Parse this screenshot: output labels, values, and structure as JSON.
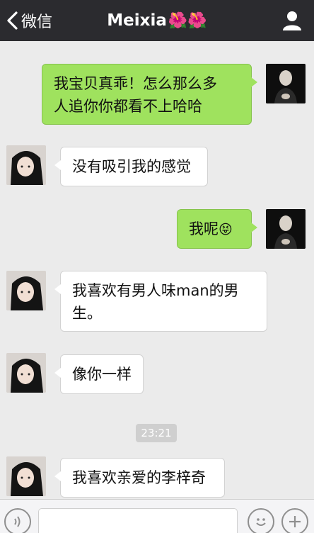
{
  "header": {
    "back_label": "微信",
    "title": "Meixia",
    "title_emoji": "🌺🌺"
  },
  "messages": [
    {
      "side": "me",
      "text_line1": "我宝贝真乖！怎么那么多",
      "text_line2": "人追你你都看不上哈哈"
    },
    {
      "side": "her",
      "text": "没有吸引我的感觉"
    },
    {
      "side": "me",
      "text": "我呢",
      "emoji": "😝"
    },
    {
      "side": "her",
      "text_line1": "我喜欢有男人味man的男",
      "text_line2": "生。"
    },
    {
      "side": "her",
      "text": "像你一样"
    },
    {
      "side": "her",
      "text": "我喜欢亲爱的李梓奇"
    }
  ],
  "timestamp": "23:21",
  "input": {
    "value": "",
    "placeholder": ""
  },
  "colors": {
    "header_bg": "#2b2b2f",
    "chat_bg": "#ebebeb",
    "sent_bubble": "#9fe25e",
    "received_bubble": "#ffffff"
  },
  "icons": [
    "chevron-left-icon",
    "profile-icon",
    "voice-icon",
    "emoji-icon",
    "plus-icon"
  ]
}
